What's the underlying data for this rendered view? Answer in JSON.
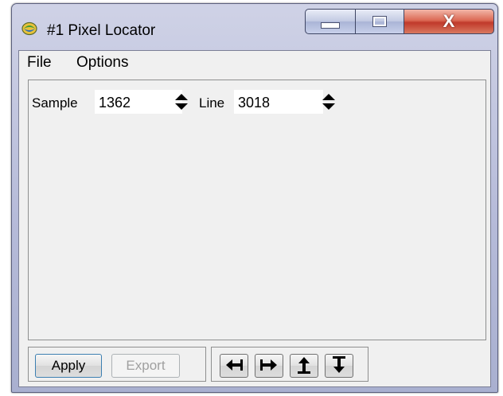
{
  "window": {
    "title": "#1 Pixel Locator",
    "close_glyph": "X"
  },
  "menu": {
    "items": [
      "File",
      "Options"
    ]
  },
  "coords": {
    "sample_label": "Sample",
    "sample_value": "1362",
    "line_label": "Line",
    "line_value": "3018"
  },
  "buttons": {
    "apply": "Apply",
    "export": "Export",
    "export_enabled": false
  },
  "nav_icons": [
    "arrow-left-icon",
    "arrow-right-icon",
    "arrow-up-icon",
    "arrow-down-icon"
  ],
  "colors": {
    "frame": "#b6bbd9",
    "close_button": "#c0392b",
    "client": "#f0f0f0"
  }
}
